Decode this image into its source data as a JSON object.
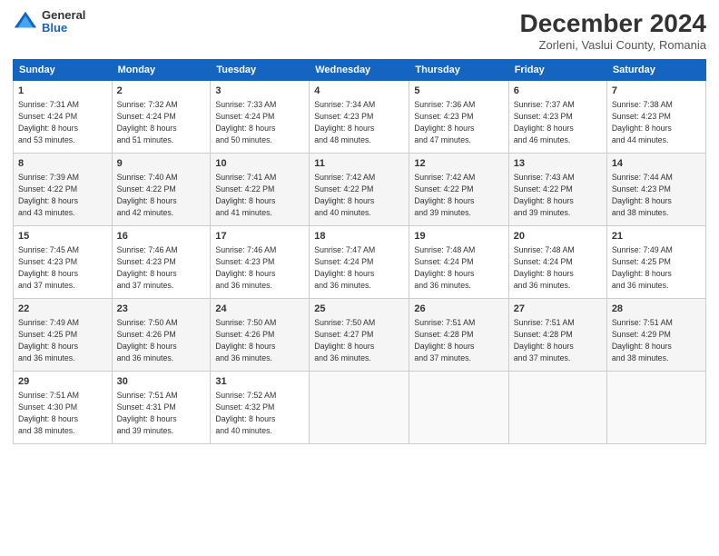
{
  "header": {
    "logo_general": "General",
    "logo_blue": "Blue",
    "month_title": "December 2024",
    "location": "Zorleni, Vaslui County, Romania"
  },
  "weekdays": [
    "Sunday",
    "Monday",
    "Tuesday",
    "Wednesday",
    "Thursday",
    "Friday",
    "Saturday"
  ],
  "weeks": [
    [
      {
        "day": "1",
        "info": "Sunrise: 7:31 AM\nSunset: 4:24 PM\nDaylight: 8 hours\nand 53 minutes."
      },
      {
        "day": "2",
        "info": "Sunrise: 7:32 AM\nSunset: 4:24 PM\nDaylight: 8 hours\nand 51 minutes."
      },
      {
        "day": "3",
        "info": "Sunrise: 7:33 AM\nSunset: 4:24 PM\nDaylight: 8 hours\nand 50 minutes."
      },
      {
        "day": "4",
        "info": "Sunrise: 7:34 AM\nSunset: 4:23 PM\nDaylight: 8 hours\nand 48 minutes."
      },
      {
        "day": "5",
        "info": "Sunrise: 7:36 AM\nSunset: 4:23 PM\nDaylight: 8 hours\nand 47 minutes."
      },
      {
        "day": "6",
        "info": "Sunrise: 7:37 AM\nSunset: 4:23 PM\nDaylight: 8 hours\nand 46 minutes."
      },
      {
        "day": "7",
        "info": "Sunrise: 7:38 AM\nSunset: 4:23 PM\nDaylight: 8 hours\nand 44 minutes."
      }
    ],
    [
      {
        "day": "8",
        "info": "Sunrise: 7:39 AM\nSunset: 4:22 PM\nDaylight: 8 hours\nand 43 minutes."
      },
      {
        "day": "9",
        "info": "Sunrise: 7:40 AM\nSunset: 4:22 PM\nDaylight: 8 hours\nand 42 minutes."
      },
      {
        "day": "10",
        "info": "Sunrise: 7:41 AM\nSunset: 4:22 PM\nDaylight: 8 hours\nand 41 minutes."
      },
      {
        "day": "11",
        "info": "Sunrise: 7:42 AM\nSunset: 4:22 PM\nDaylight: 8 hours\nand 40 minutes."
      },
      {
        "day": "12",
        "info": "Sunrise: 7:42 AM\nSunset: 4:22 PM\nDaylight: 8 hours\nand 39 minutes."
      },
      {
        "day": "13",
        "info": "Sunrise: 7:43 AM\nSunset: 4:22 PM\nDaylight: 8 hours\nand 39 minutes."
      },
      {
        "day": "14",
        "info": "Sunrise: 7:44 AM\nSunset: 4:23 PM\nDaylight: 8 hours\nand 38 minutes."
      }
    ],
    [
      {
        "day": "15",
        "info": "Sunrise: 7:45 AM\nSunset: 4:23 PM\nDaylight: 8 hours\nand 37 minutes."
      },
      {
        "day": "16",
        "info": "Sunrise: 7:46 AM\nSunset: 4:23 PM\nDaylight: 8 hours\nand 37 minutes."
      },
      {
        "day": "17",
        "info": "Sunrise: 7:46 AM\nSunset: 4:23 PM\nDaylight: 8 hours\nand 36 minutes."
      },
      {
        "day": "18",
        "info": "Sunrise: 7:47 AM\nSunset: 4:24 PM\nDaylight: 8 hours\nand 36 minutes."
      },
      {
        "day": "19",
        "info": "Sunrise: 7:48 AM\nSunset: 4:24 PM\nDaylight: 8 hours\nand 36 minutes."
      },
      {
        "day": "20",
        "info": "Sunrise: 7:48 AM\nSunset: 4:24 PM\nDaylight: 8 hours\nand 36 minutes."
      },
      {
        "day": "21",
        "info": "Sunrise: 7:49 AM\nSunset: 4:25 PM\nDaylight: 8 hours\nand 36 minutes."
      }
    ],
    [
      {
        "day": "22",
        "info": "Sunrise: 7:49 AM\nSunset: 4:25 PM\nDaylight: 8 hours\nand 36 minutes."
      },
      {
        "day": "23",
        "info": "Sunrise: 7:50 AM\nSunset: 4:26 PM\nDaylight: 8 hours\nand 36 minutes."
      },
      {
        "day": "24",
        "info": "Sunrise: 7:50 AM\nSunset: 4:26 PM\nDaylight: 8 hours\nand 36 minutes."
      },
      {
        "day": "25",
        "info": "Sunrise: 7:50 AM\nSunset: 4:27 PM\nDaylight: 8 hours\nand 36 minutes."
      },
      {
        "day": "26",
        "info": "Sunrise: 7:51 AM\nSunset: 4:28 PM\nDaylight: 8 hours\nand 37 minutes."
      },
      {
        "day": "27",
        "info": "Sunrise: 7:51 AM\nSunset: 4:28 PM\nDaylight: 8 hours\nand 37 minutes."
      },
      {
        "day": "28",
        "info": "Sunrise: 7:51 AM\nSunset: 4:29 PM\nDaylight: 8 hours\nand 38 minutes."
      }
    ],
    [
      {
        "day": "29",
        "info": "Sunrise: 7:51 AM\nSunset: 4:30 PM\nDaylight: 8 hours\nand 38 minutes."
      },
      {
        "day": "30",
        "info": "Sunrise: 7:51 AM\nSunset: 4:31 PM\nDaylight: 8 hours\nand 39 minutes."
      },
      {
        "day": "31",
        "info": "Sunrise: 7:52 AM\nSunset: 4:32 PM\nDaylight: 8 hours\nand 40 minutes."
      },
      {
        "day": "",
        "info": ""
      },
      {
        "day": "",
        "info": ""
      },
      {
        "day": "",
        "info": ""
      },
      {
        "day": "",
        "info": ""
      }
    ]
  ]
}
